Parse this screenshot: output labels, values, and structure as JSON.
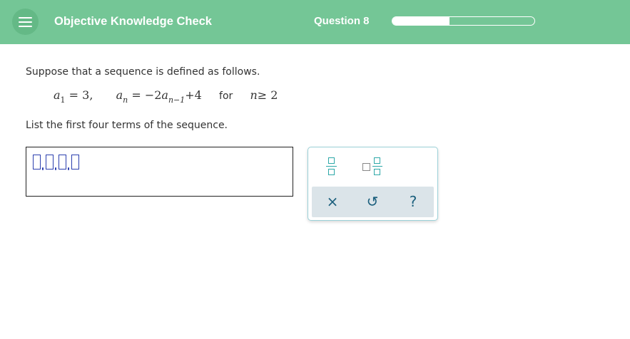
{
  "header": {
    "app_title": "Objective Knowledge Check",
    "question_label": "Question 8",
    "progress_fraction": 0.4
  },
  "problem": {
    "prompt": "Suppose that a sequence is defined as follows.",
    "formula": {
      "a1_lhs": "a",
      "a1_sub": "1",
      "a1_rhs": "= 3,",
      "an_lhs": "a",
      "an_sub": "n",
      "an_eq": "= −2",
      "an_rec": "a",
      "an_rec_sub": "n−1",
      "an_tail": "+4",
      "for_word": "for",
      "cond_var": "n",
      "cond": "≥ 2"
    },
    "instruction": "List the first four terms of the sequence."
  },
  "tools": {
    "clear_symbol": "×",
    "undo_symbol": "↺",
    "help_symbol": "?"
  },
  "colors": {
    "header_bg": "#74c696",
    "accent_teal": "#2da8a8",
    "slot_blue": "#2b3fae",
    "action_bg": "#dbe4e9"
  }
}
